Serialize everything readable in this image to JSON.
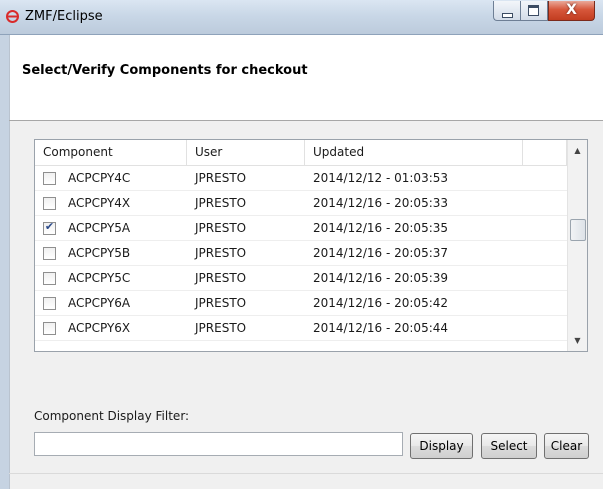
{
  "window": {
    "title": "ZMF/Eclipse",
    "minimize_label": "minimize",
    "maximize_label": "maximize",
    "close_glyph": "X"
  },
  "dialog": {
    "title": "Select/Verify Components for checkout"
  },
  "table": {
    "columns": [
      "Component",
      "User",
      "Updated",
      ""
    ],
    "rows": [
      {
        "component": "ACPCPY4C",
        "user": "JPRESTO",
        "updated": "2014/12/12 - 01:03:53",
        "checked": false
      },
      {
        "component": "ACPCPY4X",
        "user": "JPRESTO",
        "updated": "2014/12/16 - 20:05:33",
        "checked": false
      },
      {
        "component": "ACPCPY5A",
        "user": "JPRESTO",
        "updated": "2014/12/16 - 20:05:35",
        "checked": true
      },
      {
        "component": "ACPCPY5B",
        "user": "JPRESTO",
        "updated": "2014/12/16 - 20:05:37",
        "checked": false
      },
      {
        "component": "ACPCPY5C",
        "user": "JPRESTO",
        "updated": "2014/12/16 - 20:05:39",
        "checked": false
      },
      {
        "component": "ACPCPY6A",
        "user": "JPRESTO",
        "updated": "2014/12/16 - 20:05:42",
        "checked": false
      },
      {
        "component": "ACPCPY6X",
        "user": "JPRESTO",
        "updated": "2014/12/16 - 20:05:44",
        "checked": false
      }
    ]
  },
  "filter": {
    "label": "Component Display Filter:",
    "value": "",
    "placeholder": ""
  },
  "buttons": {
    "display": "Display",
    "select": "Select",
    "clear": "Clear"
  },
  "colors": {
    "close_button": "#d7573b",
    "title_bar": "#c9d7e7",
    "body_background": "#f0f0f0"
  },
  "icons": {
    "app": "red-circle-logo-icon",
    "checkbox_checked": "check-icon",
    "scroll_up": "triangle-up-icon",
    "scroll_down": "triangle-down-icon"
  }
}
